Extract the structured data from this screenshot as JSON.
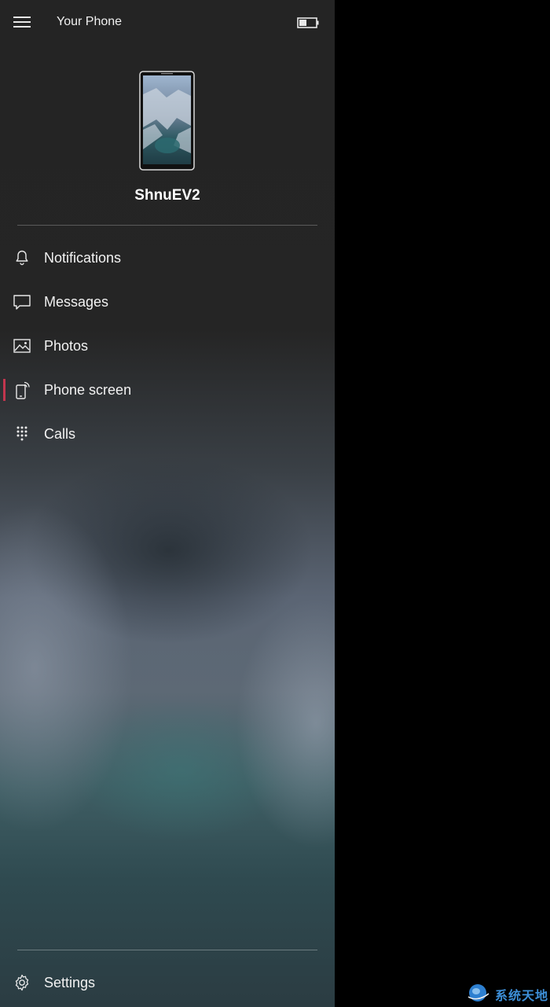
{
  "app": {
    "title": "Your Phone"
  },
  "icons": {
    "menu": "hamburger-icon",
    "battery": "battery-icon",
    "notifications": "bell-icon",
    "messages": "chat-bubble-icon",
    "photos": "image-icon",
    "phone_screen": "phone-cast-icon",
    "calls": "dialpad-icon",
    "settings": "gear-icon"
  },
  "device": {
    "name": "ShnuEV2",
    "battery_level": 0.45
  },
  "nav": {
    "items": [
      {
        "id": "notifications",
        "label": "Notifications",
        "selected": false
      },
      {
        "id": "messages",
        "label": "Messages",
        "selected": false
      },
      {
        "id": "photos",
        "label": "Photos",
        "selected": false
      },
      {
        "id": "phone_screen",
        "label": "Phone screen",
        "selected": true
      },
      {
        "id": "calls",
        "label": "Calls",
        "selected": false
      }
    ],
    "settings_label": "Settings"
  },
  "colors": {
    "accent": "#c2364e",
    "sidebar_top": "#242424",
    "window_bg": "#000000",
    "watermark": "#3d8fd8"
  },
  "watermark": {
    "text": "系统天地"
  }
}
